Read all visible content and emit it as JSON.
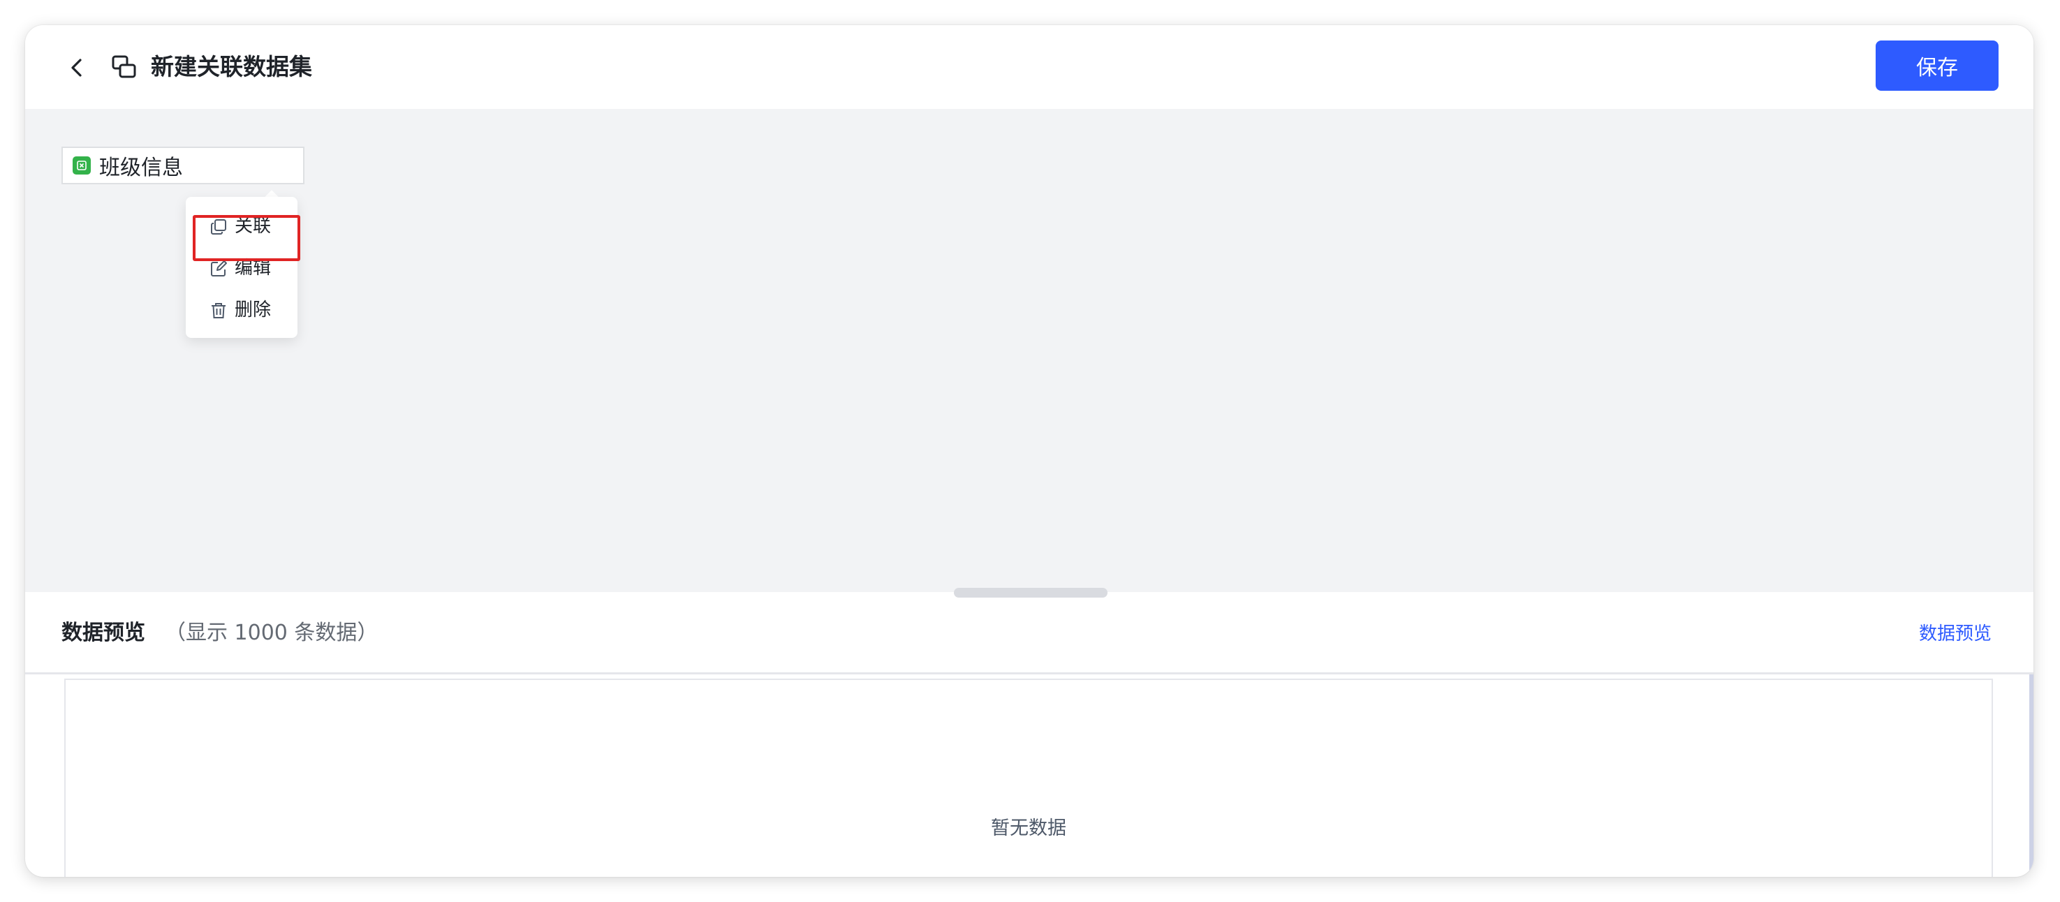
{
  "header": {
    "back_icon": "chevron-left-icon",
    "dataset_icon": "linked-dataset-icon",
    "title": "新建关联数据集",
    "save_label": "保存"
  },
  "canvas": {
    "table_node": {
      "icon": "excel-file-icon",
      "label": "班级信息"
    },
    "context_menu": {
      "items": [
        {
          "icon": "link-copy-icon",
          "label": "关联",
          "highlighted": true
        },
        {
          "icon": "edit-icon",
          "label": "编辑"
        },
        {
          "icon": "trash-icon",
          "label": "删除"
        }
      ]
    }
  },
  "preview": {
    "title": "数据预览",
    "subtitle": "（显示 1000 条数据）",
    "link_label": "数据预览",
    "empty_text": "暂无数据"
  },
  "colors": {
    "primary": "#2e5bff",
    "canvas_bg": "#f2f3f5",
    "excel_green": "#33b24a",
    "highlight_red": "#e02424"
  }
}
